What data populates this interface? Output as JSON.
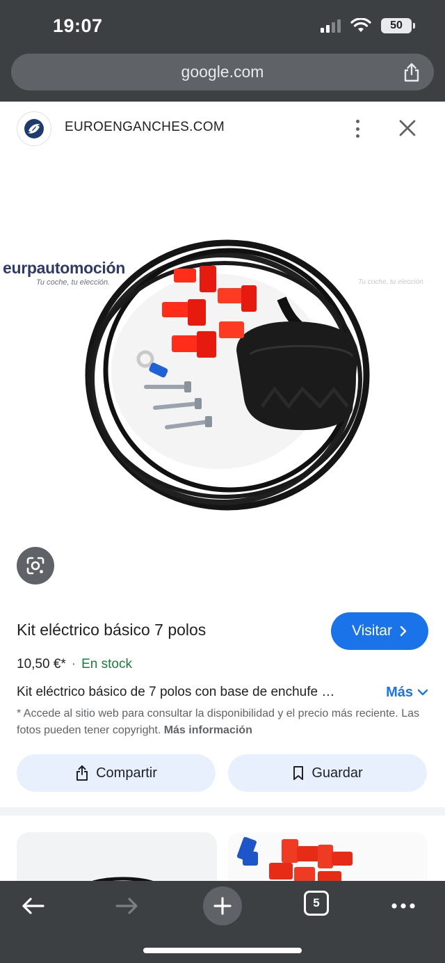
{
  "status_bar": {
    "time": "19:07",
    "battery": "50"
  },
  "url_bar": {
    "url": "google.com"
  },
  "site": {
    "name": "EUROENGANCHES.COM"
  },
  "image": {
    "brand": "eurpautomoción",
    "brand_tagline": "Tu coche, tu elección.",
    "right_watermark": "Tu coche, tu elección"
  },
  "product": {
    "title": "Kit eléctrico básico 7 polos",
    "visit_label": "Visitar",
    "price": "10,50 €*",
    "separator": "·",
    "stock": "En stock",
    "description": "Kit eléctrico básico de 7 polos con base de enchufe …",
    "more_label": "Más",
    "disclaimer": "* Accede al sitio web para consultar la disponibilidad y el precio más reciente. Las fotos pueden tener copyright.",
    "more_info_label": "Más información",
    "share_label": "Compartir",
    "save_label": "Guardar"
  },
  "toolbar": {
    "tab_count": "5"
  },
  "colors": {
    "accent": "#1a73e8",
    "stock": "#188038",
    "chrome": "#3c4043"
  }
}
